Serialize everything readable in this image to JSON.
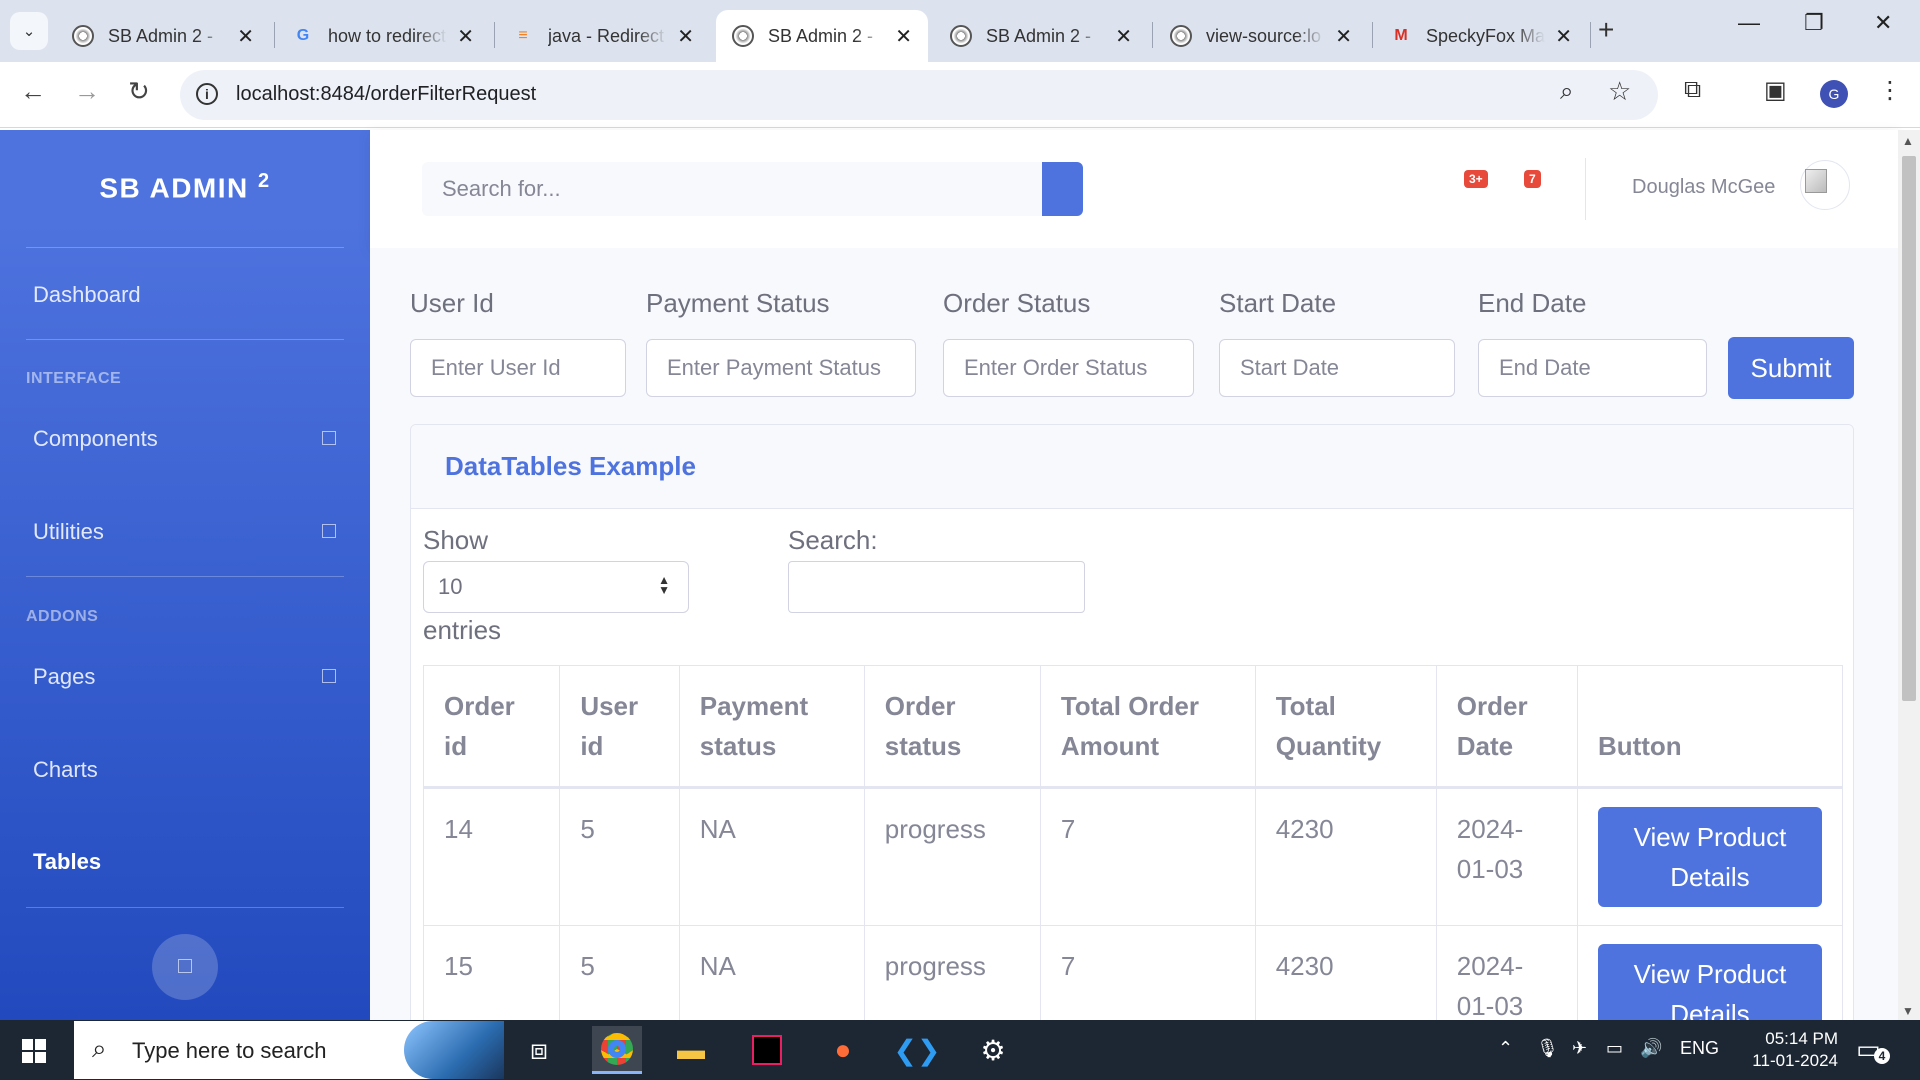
{
  "browser": {
    "tabs": [
      {
        "title": "SB Admin 2 - ",
        "favicon": "globe-icon",
        "active": false
      },
      {
        "title": "how to redirect",
        "favicon": "google-icon",
        "active": false
      },
      {
        "title": "java - Redirect",
        "favicon": "stackoverflow-icon",
        "active": false
      },
      {
        "title": "SB Admin 2 - ",
        "favicon": "globe-icon",
        "active": true
      },
      {
        "title": "SB Admin 2 - ",
        "favicon": "globe-icon",
        "active": false
      },
      {
        "title": "view-source:lo",
        "favicon": "globe-icon",
        "active": false
      },
      {
        "title": "SpeckyFox Ma",
        "favicon": "gmail-icon",
        "active": false
      }
    ],
    "url": "localhost:8484/orderFilterRequest",
    "profile_initial": "G"
  },
  "sidebar": {
    "brand": "SB ADMIN",
    "brand_sup": "2",
    "items": {
      "dashboard": "Dashboard",
      "interface_heading": "INTERFACE",
      "components": "Components",
      "utilities": "Utilities",
      "addons_heading": "ADDONS",
      "pages": "Pages",
      "charts": "Charts",
      "tables": "Tables"
    }
  },
  "topbar": {
    "search_placeholder": "Search for...",
    "alerts_badge": "3+",
    "messages_badge": "7",
    "username": "Douglas McGee"
  },
  "filters": {
    "user_id_label": "User Id",
    "user_id_placeholder": "Enter User Id",
    "payment_label": "Payment Status",
    "payment_placeholder": "Enter Payment Status",
    "order_label": "Order Status",
    "order_placeholder": "Enter Order Status",
    "start_label": "Start Date",
    "start_placeholder": "Start Date",
    "end_label": "End Date",
    "end_placeholder": "End Date",
    "submit": "Submit"
  },
  "card": {
    "title": "DataTables Example",
    "show_label": "Show",
    "page_size": "10",
    "entries_label": "entries",
    "search_label": "Search:"
  },
  "table": {
    "columns": [
      "Order id",
      "User id",
      "Payment status",
      "Order status",
      "Total Order Amount",
      "Total Quantity",
      "Order Date",
      "Button"
    ],
    "rows": [
      {
        "order_id": "14",
        "user_id": "5",
        "payment": "NA",
        "status": "progress",
        "amount": "7",
        "quantity": "4230",
        "date": "2024-01-03",
        "button": "View Product Details"
      },
      {
        "order_id": "15",
        "user_id": "5",
        "payment": "NA",
        "status": "progress",
        "amount": "7",
        "quantity": "4230",
        "date": "2024-01-03",
        "button": "View Product Details"
      }
    ]
  },
  "taskbar": {
    "search_placeholder": "Type here to search",
    "lang": "ENG",
    "time": "05:14 PM",
    "date": "11-01-2024",
    "notifications": "4"
  },
  "colors": {
    "primary": "#4e73df",
    "danger": "#e74a3b",
    "text_muted": "#858796"
  }
}
